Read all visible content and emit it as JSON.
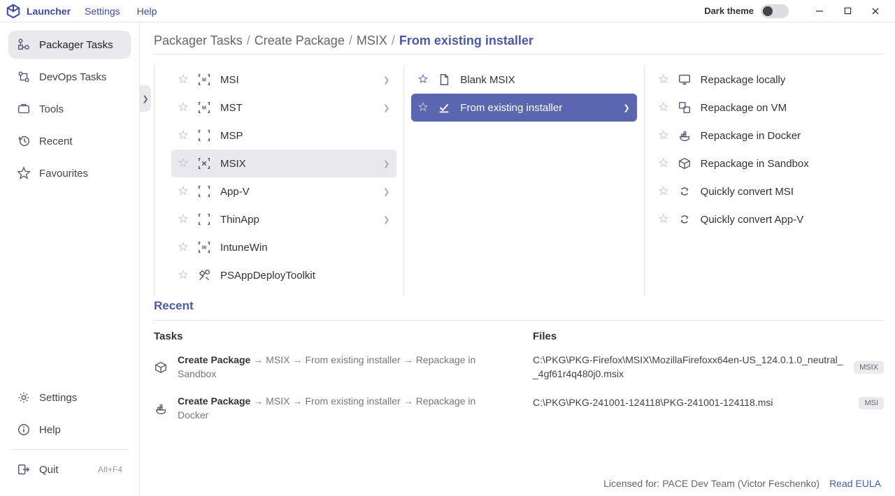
{
  "titlebar": {
    "app_name": "Launcher",
    "menu": [
      "Settings",
      "Help"
    ],
    "dark_theme_label": "Dark theme"
  },
  "sidebar": {
    "top": [
      {
        "icon": "packager",
        "label": "Packager Tasks",
        "active": true
      },
      {
        "icon": "devops",
        "label": "DevOps Tasks"
      },
      {
        "icon": "tools",
        "label": "Tools"
      },
      {
        "icon": "recent",
        "label": "Recent"
      },
      {
        "icon": "star",
        "label": "Favourites"
      }
    ],
    "bottom": [
      {
        "icon": "gear",
        "label": "Settings"
      },
      {
        "icon": "info",
        "label": "Help"
      },
      {
        "icon": "quit",
        "label": "Quit",
        "shortcut": "Alt+F4"
      }
    ]
  },
  "breadcrumb": [
    "Packager Tasks",
    "Create Package",
    "MSIX",
    "From existing installer"
  ],
  "columns": {
    "col1": [
      {
        "icon": "msi",
        "label": "MSI",
        "chevron": true
      },
      {
        "icon": "msi",
        "label": "MST",
        "chevron": true
      },
      {
        "icon": "bracket",
        "label": "MSP"
      },
      {
        "icon": "bracketx",
        "label": "MSIX",
        "selected": "grey",
        "chevron": true
      },
      {
        "icon": "bracket",
        "label": "App-V",
        "chevron": true
      },
      {
        "icon": "bracket",
        "label": "ThinApp",
        "chevron": true
      },
      {
        "icon": "bracketw",
        "label": "IntuneWin"
      },
      {
        "icon": "tools2",
        "label": "PSAppDeployToolkit"
      }
    ],
    "col2": [
      {
        "icon": "doc",
        "label": "Blank MSIX",
        "star_blue": true
      },
      {
        "icon": "check",
        "label": "From existing installer",
        "selected": "blue",
        "chevron": true
      }
    ],
    "col3": [
      {
        "icon": "monitor",
        "label": "Repackage locally"
      },
      {
        "icon": "vm",
        "label": "Repackage on VM"
      },
      {
        "icon": "docker",
        "label": "Repackage in Docker"
      },
      {
        "icon": "sandbox",
        "label": "Repackage in Sandbox"
      },
      {
        "icon": "convert",
        "label": "Quickly convert MSI"
      },
      {
        "icon": "convert",
        "label": "Quickly convert App-V"
      }
    ]
  },
  "recent": {
    "header": "Recent",
    "tasks_label": "Tasks",
    "files_label": "Files",
    "tasks": [
      {
        "icon": "sandbox",
        "parts": [
          "Create Package",
          "MSIX",
          "From existing installer",
          "Repackage in Sandbox"
        ]
      },
      {
        "icon": "docker",
        "parts": [
          "Create Package",
          "MSIX",
          "From existing installer",
          "Repackage in Docker"
        ]
      }
    ],
    "files": [
      {
        "path": "C:\\PKG\\PKG-Firefox\\MSIX\\MozillaFirefoxx64en-US_124.0.1.0_neutral__4gf61r4q480j0.msix",
        "badge": "MSIX"
      },
      {
        "path": "C:\\PKG\\PKG-241001-124118\\PKG-241001-124118.msi",
        "badge": "MSI"
      }
    ]
  },
  "footer": {
    "licensed": "Licensed for: PACE Dev Team (Victor Feschenko)",
    "eula": "Read EULA"
  }
}
